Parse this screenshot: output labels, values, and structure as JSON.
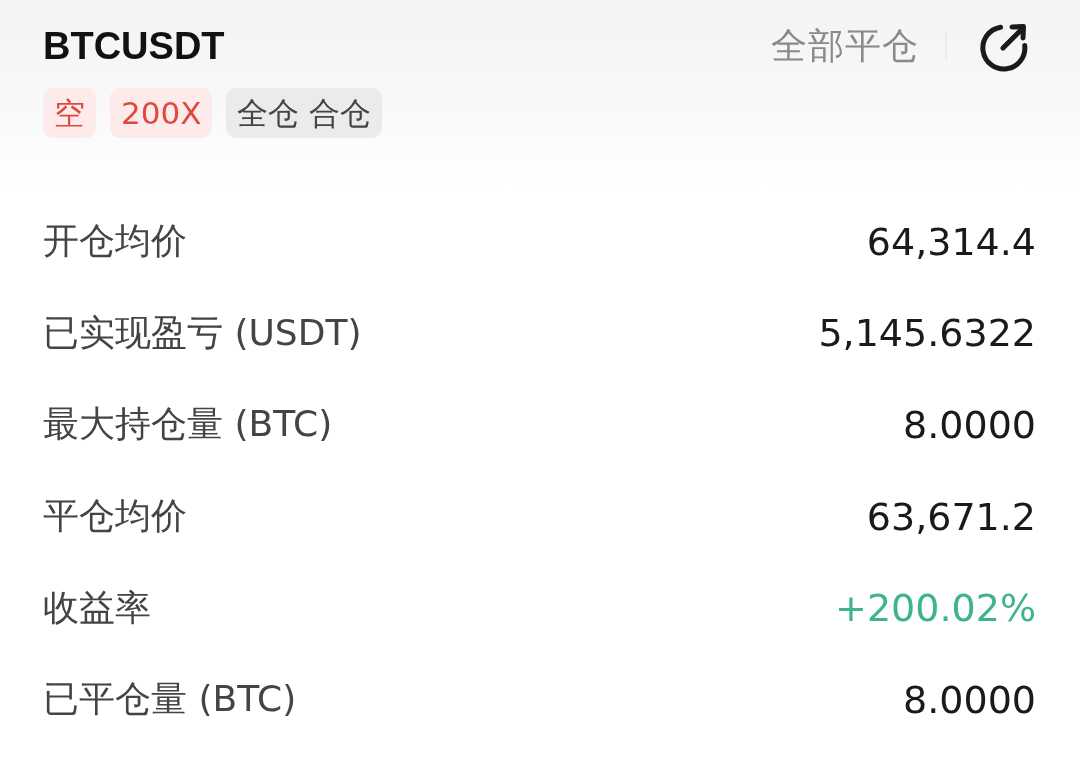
{
  "header": {
    "symbol": "BTCUSDT",
    "tags": [
      {
        "label": "空",
        "color": "#e0483e"
      },
      {
        "label": "200X",
        "color": "#e0483e"
      },
      {
        "label": "全仓 合仓",
        "color": "#454545"
      }
    ],
    "close_all_button": "全部平仓"
  },
  "rows": [
    {
      "label": "开仓均价",
      "value": "64,314.4",
      "color": "#1a1a1a"
    },
    {
      "label": "已实现盈亏 (USDT)",
      "value": "5,145.6322",
      "color": "#1a1a1a"
    },
    {
      "label": "最大持仓量 (BTC)",
      "value": "8.0000",
      "color": "#1a1a1a"
    },
    {
      "label": "平仓均价",
      "value": "63,671.2",
      "color": "#1a1a1a"
    },
    {
      "label": "收益率",
      "value": "+200.02%",
      "color": "#3db48a"
    },
    {
      "label": "已平仓量 (BTC)",
      "value": "8.0000",
      "color": "#1a1a1a"
    }
  ]
}
